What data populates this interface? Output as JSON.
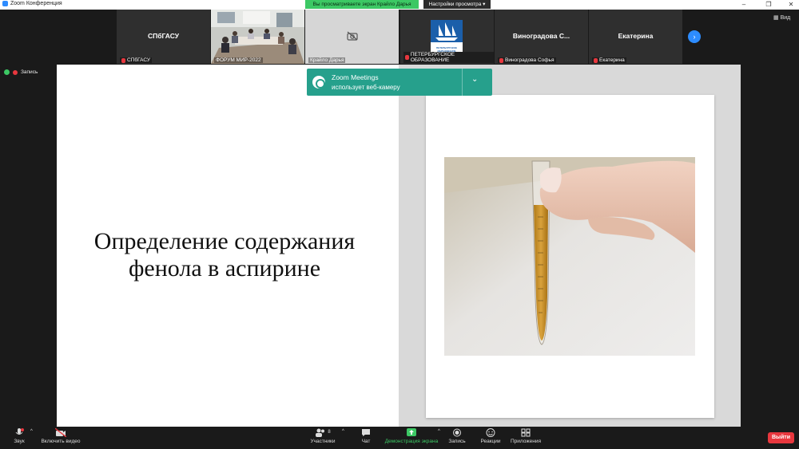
{
  "titlebar": {
    "app_title": "Zoom Конференция",
    "view_banner": "Вы просматриваете экран Крайло Дарья",
    "view_options": "Настройки просмотра ▾"
  },
  "strip": {
    "view_label": "Вид",
    "tiles": [
      {
        "name": "СПбГАСУ",
        "label": "СПбГАСУ"
      },
      {
        "name": "",
        "label": "ФОРУМ МИР-2022"
      },
      {
        "name": "",
        "label": "Крайло Дарья"
      },
      {
        "name": "",
        "label": "ПЕТЕРБУРГСКОЕ ОБРАЗОВАНИЕ"
      },
      {
        "name": "Виноградова С...",
        "label": "Виноградова Софья"
      },
      {
        "name": "Екатерина",
        "label": "Екатерина"
      }
    ],
    "logo_text": "ПЕТЕРБУРГСКОЕ ОБРАЗОВАНИЕ"
  },
  "recording": {
    "label": "Запись"
  },
  "slide": {
    "title": "Определение содержания фенола в аспирине"
  },
  "toast": {
    "title": "Zoom Meetings",
    "message": "использует веб-камеру"
  },
  "toolbar": {
    "audio": "Звук",
    "video": "Включить видео",
    "participants": "Участники",
    "participants_count": "8",
    "chat": "Чат",
    "share": "Демонстрация экрана",
    "record": "Запись",
    "reactions": "Реакции",
    "apps": "Приложения",
    "leave": "Выйти"
  },
  "colors": {
    "accent_blue": "#2d8cff",
    "share_green": "#3cc864",
    "toast_teal": "#26a08c",
    "leave_red": "#e8373e"
  }
}
